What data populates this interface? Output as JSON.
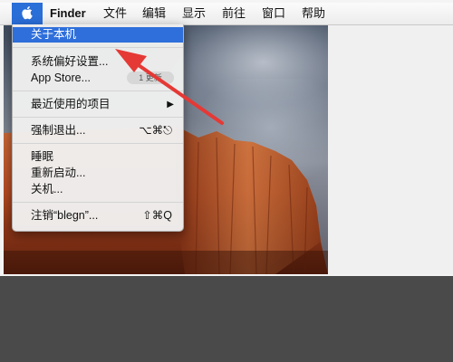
{
  "menubar": {
    "app_name": "Finder",
    "items": [
      "文件",
      "编辑",
      "显示",
      "前往",
      "窗口",
      "帮助"
    ]
  },
  "apple_menu": {
    "about": "关于本机",
    "system_prefs": "系统偏好设置...",
    "app_store": "App Store...",
    "app_store_badge": "1 更新",
    "recent_items": "最近使用的项目",
    "force_quit": "强制退出...",
    "force_quit_shortcut": "⌥⌘⎋",
    "sleep": "睡眠",
    "restart": "重新启动...",
    "shutdown": "关机...",
    "logout": "注销“blegn”...",
    "logout_shortcut": "⇧⌘Q"
  },
  "colors": {
    "highlight": "#2e6fdb",
    "annotation_arrow": "#e53935"
  }
}
